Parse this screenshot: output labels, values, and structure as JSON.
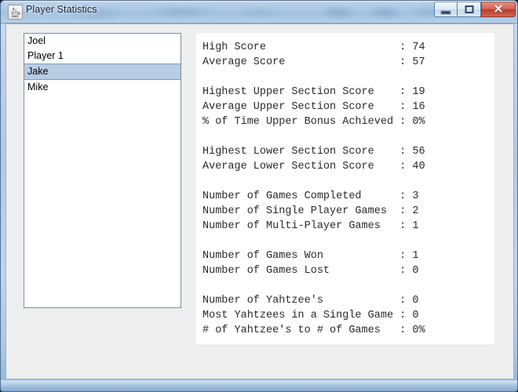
{
  "window": {
    "title": "Player Statistics",
    "app_icon": "java-coffee-cup-icon",
    "controls": {
      "minimize": "minimize-icon",
      "maximize": "maximize-icon",
      "close": "✕"
    }
  },
  "colors": {
    "selection_bg": "#b8cce4",
    "selection_border": "#7a9cc6",
    "client_bg": "#eeeeee",
    "panel_bg": "#ffffff",
    "close_button": "#ba3c2c",
    "titlebar": "#a9c7e3"
  },
  "player_list": {
    "items": [
      {
        "label": "Joel",
        "selected": false
      },
      {
        "label": "Player 1",
        "selected": false
      },
      {
        "label": "Jake",
        "selected": true
      },
      {
        "label": "Mike",
        "selected": false
      }
    ]
  },
  "statistics": {
    "groups": [
      {
        "rows": [
          {
            "label": "High Score",
            "value": "74"
          },
          {
            "label": "Average Score",
            "value": "57"
          }
        ]
      },
      {
        "rows": [
          {
            "label": "Highest Upper Section Score",
            "value": "19"
          },
          {
            "label": "Average Upper Section Score",
            "value": "16"
          },
          {
            "label": "% of Time Upper Bonus Achieved",
            "value": "0%"
          }
        ]
      },
      {
        "rows": [
          {
            "label": "Highest Lower Section Score",
            "value": "56"
          },
          {
            "label": "Average Lower Section Score",
            "value": "40"
          }
        ]
      },
      {
        "rows": [
          {
            "label": "Number of Games Completed",
            "value": "3"
          },
          {
            "label": "Number of Single Player Games",
            "value": "2"
          },
          {
            "label": "Number of Multi-Player Games",
            "value": "1"
          }
        ]
      },
      {
        "rows": [
          {
            "label": "Number of Games Won",
            "value": "1"
          },
          {
            "label": "Number of Games Lost",
            "value": "0"
          }
        ]
      },
      {
        "rows": [
          {
            "label": "Number of Yahtzee's",
            "value": "0"
          },
          {
            "label": "Most Yahtzees in a Single Game",
            "value": "0"
          },
          {
            "label": "# of Yahtzee's to # of Games",
            "value": "0%"
          }
        ]
      }
    ],
    "text": "High Score                     : 74\nAverage Score                  : 57\n\nHighest Upper Section Score    : 19\nAverage Upper Section Score    : 16\n% of Time Upper Bonus Achieved : 0%\n\nHighest Lower Section Score    : 56\nAverage Lower Section Score    : 40\n\nNumber of Games Completed      : 3\nNumber of Single Player Games  : 2\nNumber of Multi-Player Games   : 1\n\nNumber of Games Won            : 1\nNumber of Games Lost           : 0\n\nNumber of Yahtzee's            : 0\nMost Yahtzees in a Single Game : 0\n# of Yahtzee's to # of Games   : 0%"
  }
}
